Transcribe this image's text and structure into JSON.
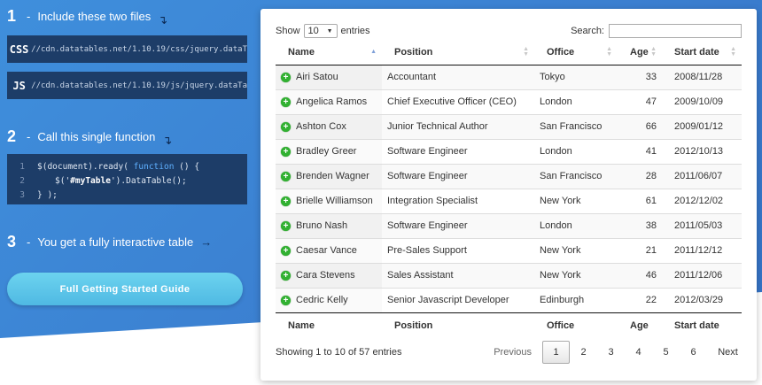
{
  "steps": [
    {
      "num": "1",
      "text": "Include these two files",
      "arrow": "↴"
    },
    {
      "num": "2",
      "text": "Call this single function",
      "arrow": "↴"
    },
    {
      "num": "3",
      "text": "You get a fully interactive table",
      "arrow": "→"
    }
  ],
  "files": [
    {
      "lang": "CSS",
      "url": "//cdn.datatables.net/1.10.19/css/jquery.dataT"
    },
    {
      "lang": "JS",
      "url": "//cdn.datatables.net/1.10.19/js/jquery.dataTa"
    }
  ],
  "snippet": {
    "line_numbers": [
      "1",
      "2",
      "3"
    ],
    "line1_a": "$(document).ready( ",
    "line1_kw": "function",
    "line1_b": " () {",
    "line2_a": "$('",
    "line2_str": "#myTable",
    "line2_b": "').DataTable();",
    "line3": "} );"
  },
  "cta_label": "Full Getting Started Guide",
  "table_controls": {
    "show_label": "Show",
    "entries_value": "10",
    "entries_label": "entries",
    "search_label": "Search:",
    "search_value": ""
  },
  "columns": [
    "Name",
    "Position",
    "Office",
    "Age",
    "Start date"
  ],
  "rows": [
    [
      "Airi Satou",
      "Accountant",
      "Tokyo",
      "33",
      "2008/11/28"
    ],
    [
      "Angelica Ramos",
      "Chief Executive Officer (CEO)",
      "London",
      "47",
      "2009/10/09"
    ],
    [
      "Ashton Cox",
      "Junior Technical Author",
      "San Francisco",
      "66",
      "2009/01/12"
    ],
    [
      "Bradley Greer",
      "Software Engineer",
      "London",
      "41",
      "2012/10/13"
    ],
    [
      "Brenden Wagner",
      "Software Engineer",
      "San Francisco",
      "28",
      "2011/06/07"
    ],
    [
      "Brielle Williamson",
      "Integration Specialist",
      "New York",
      "61",
      "2012/12/02"
    ],
    [
      "Bruno Nash",
      "Software Engineer",
      "London",
      "38",
      "2011/05/03"
    ],
    [
      "Caesar Vance",
      "Pre-Sales Support",
      "New York",
      "21",
      "2011/12/12"
    ],
    [
      "Cara Stevens",
      "Sales Assistant",
      "New York",
      "46",
      "2011/12/06"
    ],
    [
      "Cedric Kelly",
      "Senior Javascript Developer",
      "Edinburgh",
      "22",
      "2012/03/29"
    ]
  ],
  "info": "Showing 1 to 10 of 57 entries",
  "pagination": {
    "previous": "Previous",
    "pages": [
      "1",
      "2",
      "3",
      "4",
      "5",
      "6"
    ],
    "current": "1",
    "next": "Next"
  },
  "colors": {
    "accent_blue": "#3b7fd0",
    "code_bg": "#1d3d68",
    "cta": "#5fc6ea",
    "expand_green": "#31b131"
  }
}
